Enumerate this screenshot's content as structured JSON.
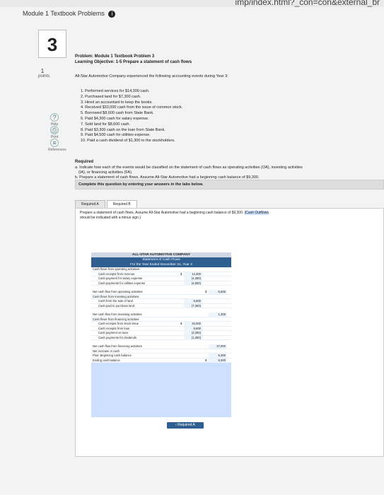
{
  "browser": {
    "url_fragment": "imp/index.html?_con=con&external_br"
  },
  "header": {
    "module_title": "Module 1 Textbook Problems",
    "info_icon": "i"
  },
  "question": {
    "number": "3",
    "points_value": "1",
    "points_label": "points"
  },
  "sidebar": [
    {
      "icon": "help-icon",
      "glyph": "?",
      "label": "Help"
    },
    {
      "icon": "print-icon",
      "glyph": "⎙",
      "label": "Print"
    },
    {
      "icon": "references-icon",
      "glyph": "≡",
      "label": "References"
    }
  ],
  "problem": {
    "title": "Problem: Module 1 Textbook Problem 3",
    "objective": "Learning Objective: 1-5 Prepare a statement of cash flows",
    "intro": "All-Star Automotive Company experienced the following accounting events during Year 3:",
    "events": [
      "1. Performed services for $14,300 cash.",
      "2. Purchased land for $7,300 cash.",
      "3. Hired an accountant to keep the books.",
      "4. Received $33,000 cash from the issue of common stock.",
      "5. Borrowed $8,600 cash from State Bank.",
      "6. Paid $4,300 cash for salary expense.",
      "7. Sold land for $8,600 cash.",
      "8. Paid $3,300 cash on the loan from State Bank.",
      "9. Paid $4,500 cash for utilities expense.",
      "10. Paid a cash dividend of $1,300 to the stockholders."
    ]
  },
  "required": {
    "title": "Required",
    "a1": "a. Indicate how each of the events would be classified on the statement of cash flows as operating activities (OA), investing activities",
    "a2": "(IA), or financing activities (FA).",
    "b": "b. Prepare a statement of cash flows. Assume All-Star Automotive had a beginning cash balance of $9,300."
  },
  "complete_bar": "Complete this question by entering your answers in the tabs below.",
  "tabs": [
    {
      "label": "Required A",
      "active": false
    },
    {
      "label": "Required B",
      "active": true
    }
  ],
  "instruction_a": "Prepare a statement of cash flows. Assume All-Star Automotive had a beginning cash balance of $9,300. ",
  "instruction_hl": "(Cash Outflows",
  "instruction_b": "should be indicated with a minus sign.)",
  "statement": {
    "company": "ALL-STAR AUTOMOTIVE COMPANY",
    "title": "Statement of Cash Flows",
    "period": "For the Year Ended December 31, Year 3",
    "rows": [
      {
        "label": "Cash flows from operating activities:",
        "indent": 0,
        "cur1": "",
        "v1": "",
        "cur2": "",
        "v2": ""
      },
      {
        "label": "Cash receipts from revenue",
        "indent": 1,
        "cur1": "$",
        "v1": "14,300",
        "cur2": "",
        "v2": ""
      },
      {
        "label": "Cash payment for salary expense",
        "indent": 1,
        "cur1": "",
        "v1": "(4,300)",
        "cur2": "",
        "v2": ""
      },
      {
        "label": "Cash payments for utilities expense",
        "indent": 1,
        "cur1": "",
        "v1": "(4,500)",
        "cur2": "",
        "v2": ""
      },
      {
        "gap": true
      },
      {
        "label": "Net cash flow from operating activities",
        "indent": 0,
        "cur1": "",
        "v1": "",
        "cur2": "$",
        "v2": "5,500"
      },
      {
        "label": "Cash flows from investing activities:",
        "indent": 0,
        "cur1": "",
        "v1": "",
        "cur2": "",
        "v2": ""
      },
      {
        "label": "Cash from the sale of land",
        "indent": 1,
        "cur1": "",
        "v1": "8,600",
        "cur2": "",
        "v2": ""
      },
      {
        "label": "Cash paid to purchase land",
        "indent": 1,
        "cur1": "",
        "v1": "(7,300)",
        "cur2": "",
        "v2": ""
      },
      {
        "gap": true
      },
      {
        "label": "Net cash flow from investing activities",
        "indent": 0,
        "cur1": "",
        "v1": "",
        "cur2": "",
        "v2": "1,300"
      },
      {
        "label": "Cash flows from financing activities:",
        "indent": 0,
        "cur1": "",
        "v1": "",
        "cur2": "",
        "v2": ""
      },
      {
        "label": "Cash receipts from stock issue",
        "indent": 1,
        "cur1": "$",
        "v1": "33,000",
        "cur2": "",
        "v2": ""
      },
      {
        "label": "Cash receipts from loan",
        "indent": 1,
        "cur1": "",
        "v1": "8,600",
        "cur2": "",
        "v2": ""
      },
      {
        "label": "Cash payment on loan",
        "indent": 1,
        "cur1": "",
        "v1": "(3,300)",
        "cur2": "",
        "v2": ""
      },
      {
        "label": "Cash payments for dividends",
        "indent": 1,
        "cur1": "",
        "v1": "(1,300)",
        "cur2": "",
        "v2": ""
      },
      {
        "gap": true
      },
      {
        "label": "Net cash flow from financing activities",
        "indent": 0,
        "cur1": "",
        "v1": "",
        "cur2": "",
        "v2": "37,000"
      },
      {
        "label": "Net increase in cash",
        "indent": 0,
        "cur1": "",
        "v1": "",
        "cur2": "",
        "v2": ""
      },
      {
        "label": "Plus: Beginning cash balance",
        "indent": 0,
        "cur1": "",
        "v1": "",
        "cur2": "",
        "v2": "9,300"
      },
      {
        "label": "Ending cash balance",
        "indent": 0,
        "cur1": "",
        "v1": "",
        "cur2": "$",
        "v2": "9,300"
      }
    ]
  },
  "back_button": {
    "arrow": "‹",
    "label": "Required A"
  }
}
